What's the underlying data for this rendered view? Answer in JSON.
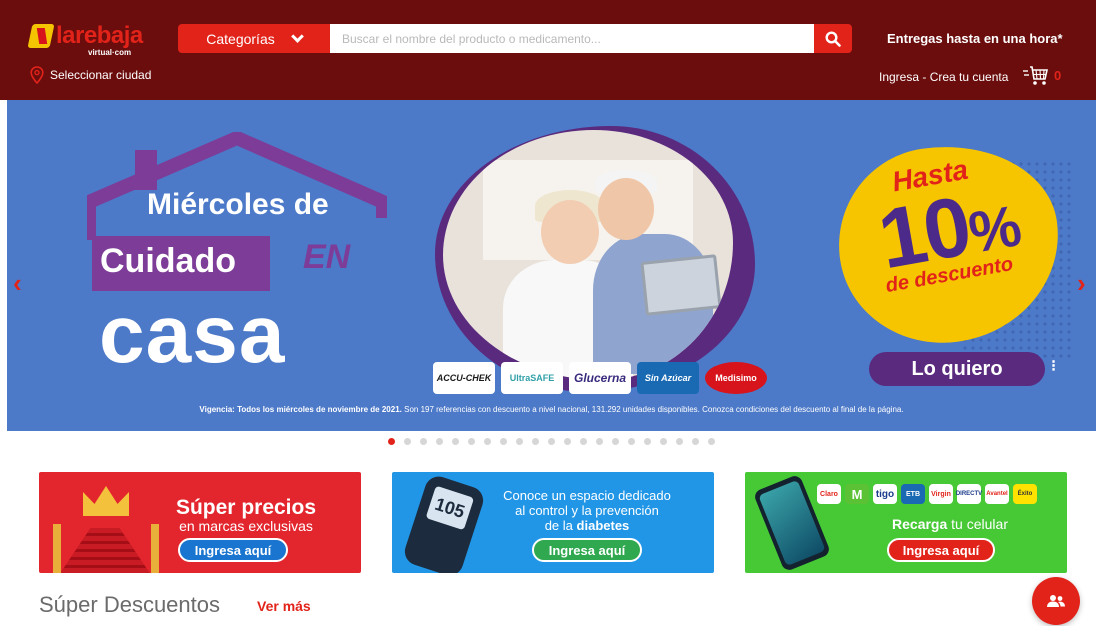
{
  "brand": {
    "logo_text": "larebaja",
    "logo_sub": "virtual·com",
    "accent_color": "#e2231a",
    "header_color": "#6b0d0d"
  },
  "header": {
    "categories_label": "Categorías",
    "search_placeholder": "Buscar el nombre del producto o medicamento...",
    "delivery_text": "Entregas hasta en una hora*",
    "city_label": "Seleccionar ciudad",
    "login_label": "Ingresa - Crea tu cuenta",
    "cart_count": "0"
  },
  "icons": [
    "search-icon",
    "location-pin-icon",
    "cart-icon",
    "chevron-down-icon",
    "arrow-left-icon",
    "arrow-right-icon",
    "people-icon"
  ],
  "hero": {
    "line1": "Miércoles de",
    "line2": "Cuidado",
    "line2b": "EN",
    "line3": "casa",
    "badge_hasta": "Hasta",
    "badge_number": "10",
    "badge_percent": "%",
    "badge_desc": "de descuento",
    "cta": "Lo quiero",
    "brands": [
      "ACCU-CHEK",
      "UltraSAFE",
      "Glucerna",
      "Sin Azúcar",
      "Medisimo"
    ],
    "vigencia_bold": "Vigencia: Todos los miércoles de noviembre de 2021.",
    "vigencia_text": "Son 197 referencias con descuento a nivel nacional, 131.292 unidades disponibles. Conozca condiciones del descuento al final de la página."
  },
  "carousel": {
    "total_slides": 21,
    "active_slide": 1
  },
  "promos": [
    {
      "title": "Súper precios",
      "subtitle": "en marcas exclusivas",
      "button": "Ingresa aquí"
    },
    {
      "text_line1": "Conoce un espacio dedicado",
      "text_line2": "al control y la prevención",
      "text_line3": "de la",
      "text_bold": "diabetes",
      "meter_value": "105",
      "button": "Ingresa aquí"
    },
    {
      "title_bold": "Recarga",
      "title_rest": "tu celular",
      "operators": [
        "Claro",
        "M",
        "tigo",
        "ETB",
        "Virgin",
        "DIRECTV",
        "Avantel",
        "Éxito"
      ],
      "button": "Ingresa aquí"
    }
  ],
  "section": {
    "title": "Súper Descuentos",
    "link": "Ver más"
  }
}
